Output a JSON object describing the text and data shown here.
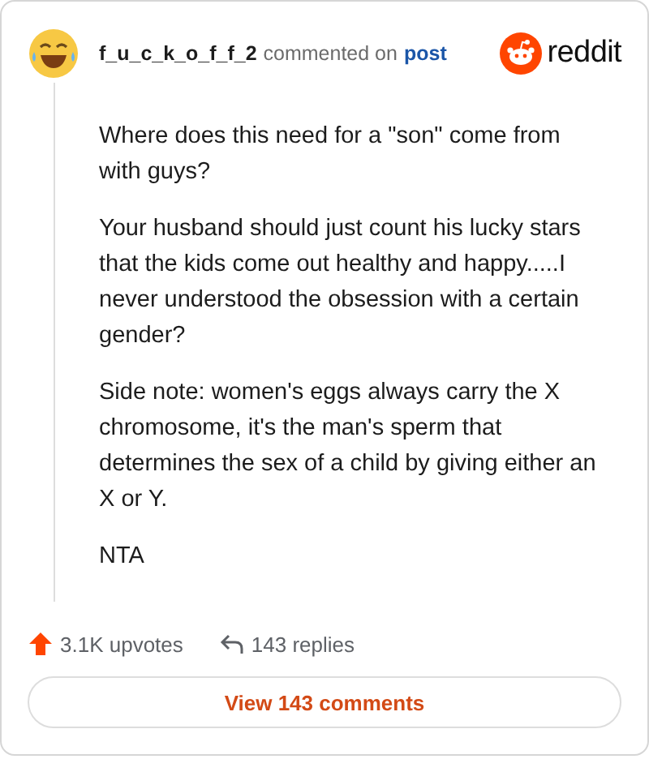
{
  "header": {
    "username": "f_u_c_k_o_f_f_2",
    "action": "commented on",
    "link": "post",
    "brand": "reddit"
  },
  "paragraphs": [
    "Where does this need for a \"son\" come from with guys?",
    "Your husband should just count his lucky stars that the kids come out healthy and happy.....I never understood the obsession with a certain gender?",
    "Side note: women's eggs always carry the X chromosome, it's the man's sperm that determines the sex of a child by giving either an X or Y.",
    "NTA"
  ],
  "footer": {
    "upvotes": "3.1K upvotes",
    "replies": "143 replies",
    "button": "View 143 comments"
  }
}
